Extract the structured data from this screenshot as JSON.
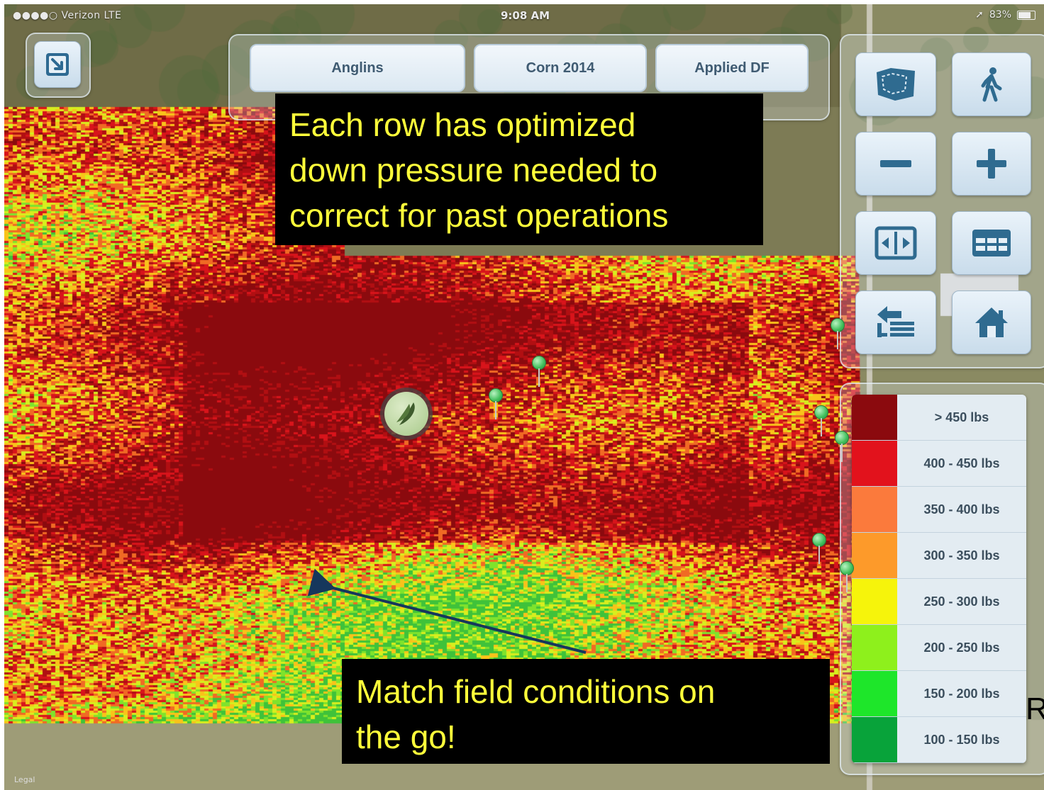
{
  "status_bar": {
    "carrier": "●●●●○ Verizon  LTE",
    "time": "9:08 AM",
    "battery": "83%",
    "battery_level": 0.83
  },
  "tabs": [
    {
      "label": "Anglins"
    },
    {
      "label": "Corn 2014"
    },
    {
      "label": "Applied DF"
    }
  ],
  "toolbar": {
    "expand_icon": "arrow-down-right-icon",
    "buttons": [
      {
        "name": "field-boundary-button",
        "icon": "field-map-icon"
      },
      {
        "name": "walk-mode-button",
        "icon": "walking-person-icon"
      },
      {
        "name": "zoom-out-button",
        "icon": "minus-icon"
      },
      {
        "name": "zoom-in-button",
        "icon": "plus-icon"
      },
      {
        "name": "fit-to-screen-button",
        "icon": "fit-arrows-icon"
      },
      {
        "name": "table-view-button",
        "icon": "table-icon"
      },
      {
        "name": "layers-button",
        "icon": "layers-list-icon"
      },
      {
        "name": "home-button",
        "icon": "home-icon"
      }
    ]
  },
  "callouts": {
    "top_lines": [
      "Each row has optimized",
      "down pressure needed to",
      "correct for past operations"
    ],
    "bottom_lines": [
      "Match field conditions on",
      "the go!"
    ]
  },
  "legend": {
    "items": [
      {
        "label": "> 450 lbs",
        "color": "#8b0a0e"
      },
      {
        "label": "400 - 450 lbs",
        "color": "#e2121c"
      },
      {
        "label": "350 - 400 lbs",
        "color": "#fb7a3c"
      },
      {
        "label": "300 - 350 lbs",
        "color": "#fd9a2a"
      },
      {
        "label": "250 - 300 lbs",
        "color": "#f6f40b"
      },
      {
        "label": "200 - 250 lbs",
        "color": "#8ef01c"
      },
      {
        "label": "150 - 200 lbs",
        "color": "#1ee62a"
      },
      {
        "label": "100 - 150 lbs",
        "color": "#08a33a"
      }
    ]
  },
  "map": {
    "legal_text": "Legal",
    "marker_icon": "seed-pod-icon",
    "edge_text": "R"
  }
}
